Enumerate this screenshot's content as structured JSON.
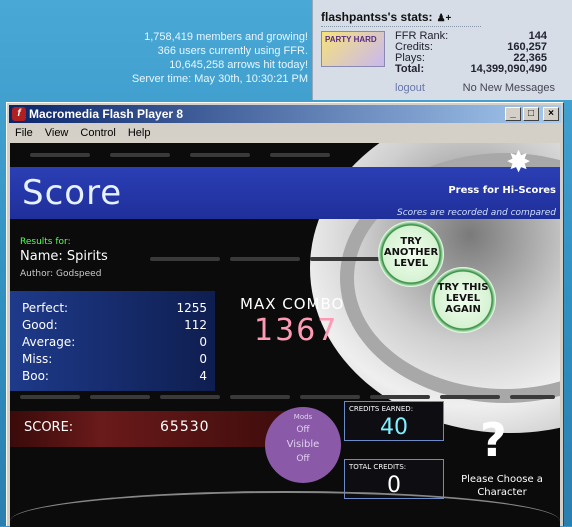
{
  "site": {
    "stats_lines": [
      "1,758,419 members and growing!",
      "366 users currently using FFR.",
      "10,645,258 arrows hit today!",
      "Server time: May 30th, 10:30:21 PM"
    ]
  },
  "user_panel": {
    "title": "flashpantss's stats:",
    "avatar_text": "PARTY HARD",
    "rows": [
      {
        "label": "FFR Rank:",
        "value": "144"
      },
      {
        "label": "Credits:",
        "value": "160,257"
      },
      {
        "label": "Plays:",
        "value": "22,365"
      },
      {
        "label": "Total:",
        "value": "14,399,090,490"
      }
    ],
    "logout": "logout",
    "messages": "No New Messages"
  },
  "window": {
    "title": "Macromedia Flash Player 8",
    "icon_letter": "f",
    "menu": [
      "File",
      "View",
      "Control",
      "Help"
    ]
  },
  "game": {
    "heading": "Score",
    "press_for": "Press for Hi-Scores",
    "recorded_note": "Scores are recorded and compared",
    "results_for": "Results for:",
    "song_name": "Name: Spirits",
    "song_author": "Author: Godspeed",
    "judgements": [
      {
        "label": "Perfect:",
        "value": "1255"
      },
      {
        "label": "Good:",
        "value": "112"
      },
      {
        "label": "Average:",
        "value": "0"
      },
      {
        "label": "Miss:",
        "value": "0"
      },
      {
        "label": "Boo:",
        "value": "4"
      }
    ],
    "max_combo_label": "MAX COMBO",
    "max_combo_value": "1367",
    "try_another": "TRY ANOTHER LEVEL",
    "try_again": "TRY THIS LEVEL AGAIN",
    "score_label": "SCORE:",
    "score_value": "65530",
    "mods": {
      "title": "Mods",
      "m1": "Off",
      "m2": "Visible",
      "m3": "Off"
    },
    "credits_earned_label": "CREDITS EARNED:",
    "credits_earned": "40",
    "total_credits_label": "TOTAL CREDITS:",
    "total_credits": "0",
    "character_symbol": "?",
    "character_note": "Please Choose a Character"
  }
}
